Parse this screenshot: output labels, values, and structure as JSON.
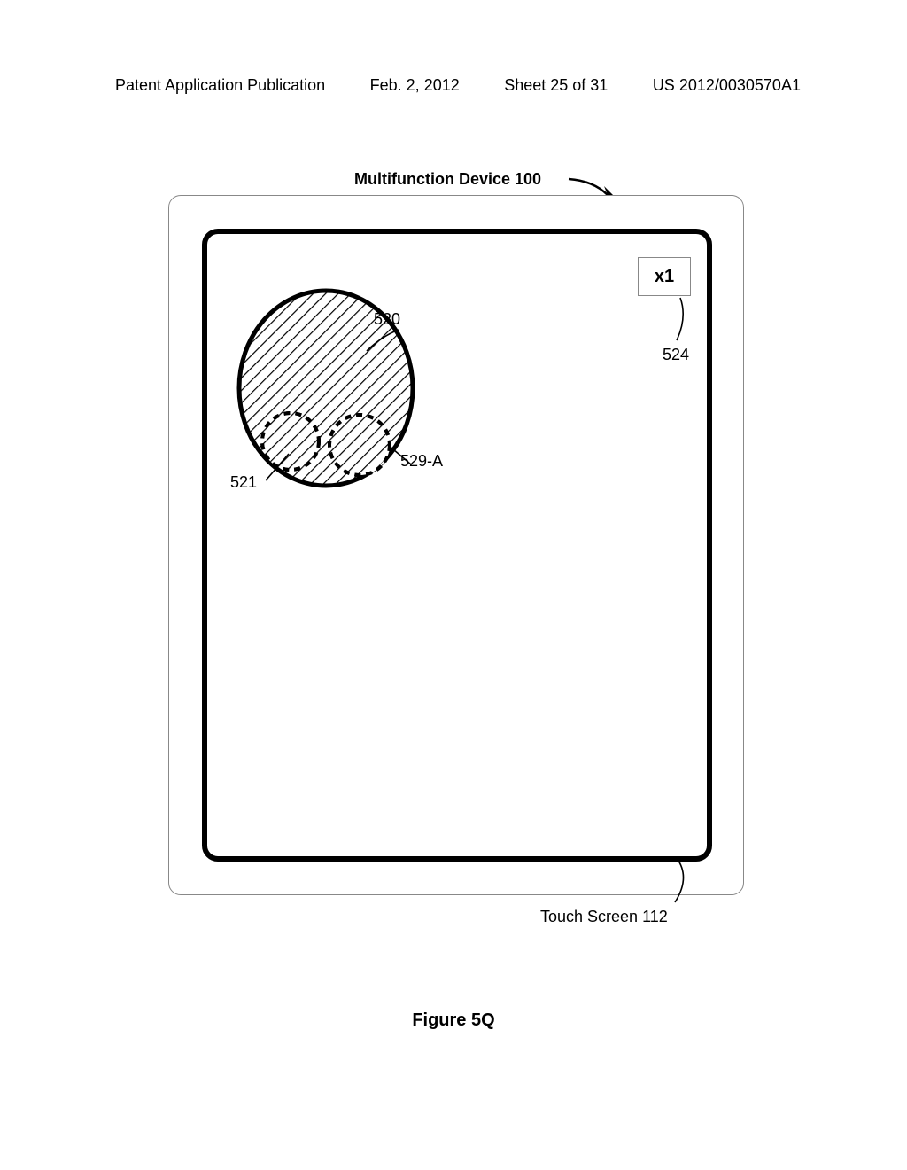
{
  "header": {
    "left": "Patent Application Publication",
    "date": "Feb. 2, 2012",
    "sheet": "Sheet 25 of 31",
    "pubnum": "US 2012/0030570A1"
  },
  "labels": {
    "device": "Multifunction Device 100",
    "touchscreen": "Touch Screen 112",
    "figure": "Figure 5Q",
    "x1": "x1",
    "x1_ref": "524",
    "oval_ref": "520",
    "left_touch_ref": "521",
    "right_touch_ref": "529-A"
  }
}
